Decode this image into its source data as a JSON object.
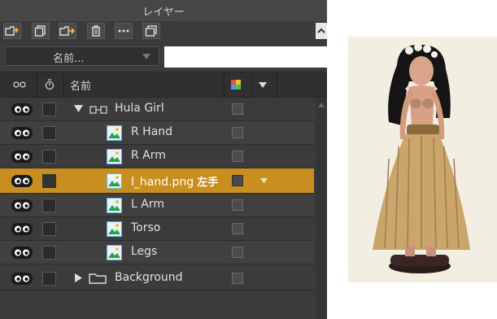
{
  "panel": {
    "title": "レイヤー",
    "toolbar": [
      {
        "name": "new-layer-button",
        "icon": "new-layer-icon"
      },
      {
        "name": "duplicate-layer-button",
        "icon": "duplicate-icon"
      },
      {
        "name": "new-group-button",
        "icon": "new-group-icon"
      },
      {
        "name": "delete-layer-button",
        "icon": "trash-icon"
      },
      {
        "name": "more-options-button",
        "icon": "ellipsis-icon"
      },
      {
        "name": "merge-layer-button",
        "icon": "stack-icon"
      }
    ],
    "sort": {
      "selected": "名前..."
    },
    "search": {
      "value": "",
      "placeholder": ""
    },
    "columns": {
      "name": "名前"
    },
    "layers": [
      {
        "label": "Hula Girl",
        "type": "group-link",
        "indent": 0,
        "expanded": true
      },
      {
        "label": "R Hand",
        "type": "image",
        "indent": 1
      },
      {
        "label": "R Arm",
        "type": "image",
        "indent": 1
      },
      {
        "label": "l_hand.png",
        "type": "image",
        "indent": 1,
        "selected": true,
        "note": "左手"
      },
      {
        "label": "L Arm",
        "type": "image",
        "indent": 1
      },
      {
        "label": "Torso",
        "type": "image",
        "indent": 1
      },
      {
        "label": "Legs",
        "type": "image",
        "indent": 1
      },
      {
        "label": "Background",
        "type": "folder",
        "indent": 0,
        "expanded": false
      }
    ]
  },
  "colors": {
    "selected_row": "#c88e1f",
    "panel_bg": "#3b3b3b"
  }
}
